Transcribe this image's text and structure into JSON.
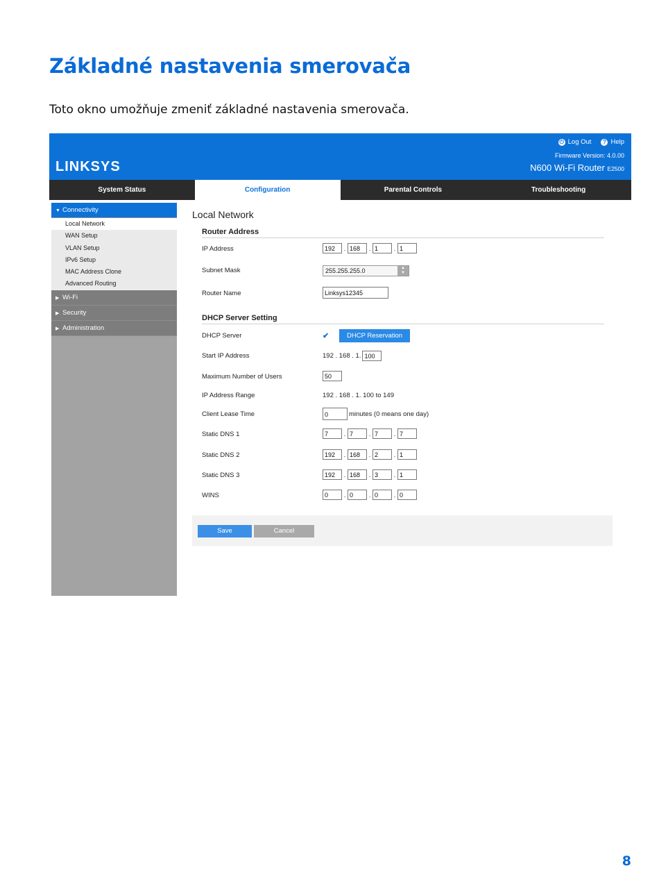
{
  "doc": {
    "title": "Základné nastavenia smerovača",
    "intro": "Toto okno umožňuje zmeniť základné nastavenia smerovača.",
    "page_number": "8"
  },
  "router": {
    "logo": "LINKSYS",
    "logout": "Log Out",
    "help": "Help",
    "firmware": "Firmware Version: 4.0.00",
    "model": "N600 Wi-Fi Router",
    "model_code": "E2500",
    "tabs": [
      "System Status",
      "Configuration",
      "Parental Controls",
      "Troubleshooting"
    ],
    "sidebar": {
      "connectivity": "Connectivity",
      "sub": [
        "Local Network",
        "WAN Setup",
        "VLAN Setup",
        "IPv6 Setup",
        "MAC Address Clone",
        "Advanced Routing"
      ],
      "wifi": "Wi-Fi",
      "security": "Security",
      "administration": "Administration"
    },
    "page_heading": "Local Network",
    "router_address": {
      "title": "Router Address",
      "ip_label": "IP Address",
      "ip": [
        "192",
        "168",
        "1",
        "1"
      ],
      "subnet_label": "Subnet Mask",
      "subnet": "255.255.255.0",
      "name_label": "Router Name",
      "name": "Linksys12345"
    },
    "dhcp": {
      "title": "DHCP Server Setting",
      "server_label": "DHCP Server",
      "reservation_button": "DHCP Reservation",
      "start_label": "Start IP Address",
      "start_prefix": "192 . 168 . 1.",
      "start_value": "100",
      "max_label": "Maximum Number of Users",
      "max_value": "50",
      "range_label": "IP Address Range",
      "range_value": "192 . 168 . 1. 100 to 149",
      "lease_label": "Client Lease Time",
      "lease_value": "0",
      "lease_suffix": "minutes (0 means one day)",
      "dns1_label": "Static DNS 1",
      "dns1": [
        "7",
        "7",
        "7",
        "7"
      ],
      "dns2_label": "Static DNS 2",
      "dns2": [
        "192",
        "168",
        "2",
        "1"
      ],
      "dns3_label": "Static DNS 3",
      "dns3": [
        "192",
        "168",
        "3",
        "1"
      ],
      "wins_label": "WINS",
      "wins": [
        "0",
        "0",
        "0",
        "0"
      ]
    },
    "save": "Save",
    "cancel": "Cancel"
  }
}
